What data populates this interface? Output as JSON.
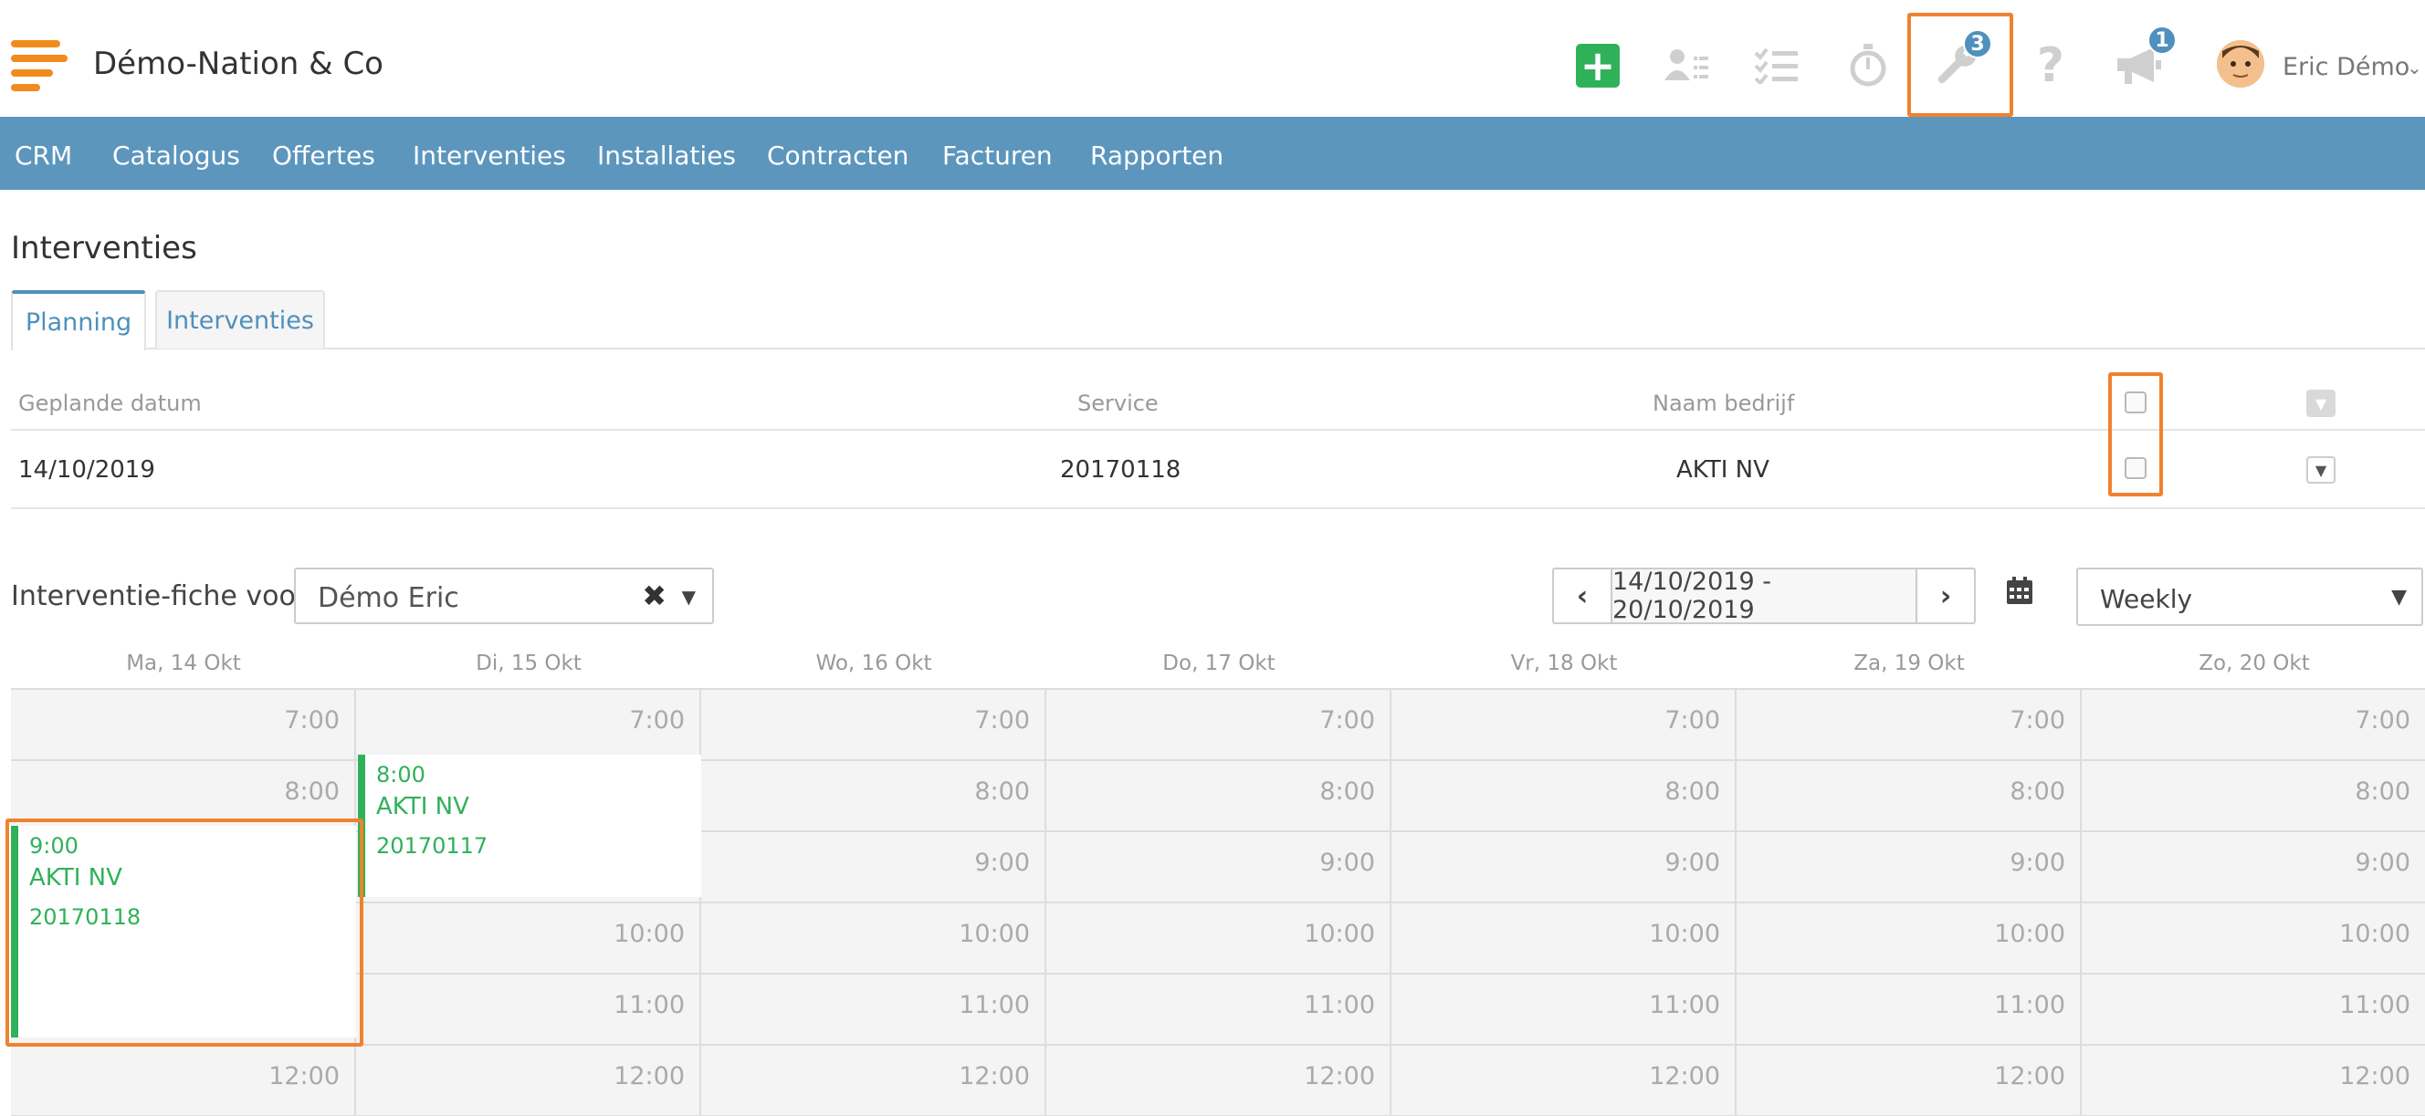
{
  "header": {
    "company": "Démo-Nation & Co",
    "tools_badge": "3",
    "announcements_badge": "1",
    "user_name": "Eric Démo",
    "icons": [
      "plus-icon",
      "contacts-icon",
      "tasks-icon",
      "stopwatch-icon",
      "wrench-icon",
      "help-icon",
      "megaphone-icon",
      "avatar"
    ]
  },
  "nav": {
    "items": [
      "CRM",
      "Catalogus",
      "Offertes",
      "Interventies",
      "Installaties",
      "Contracten",
      "Facturen",
      "Rapporten"
    ]
  },
  "page": {
    "title": "Interventies",
    "tabs": [
      "Planning",
      "Interventies"
    ]
  },
  "table": {
    "headers": [
      "Geplande datum",
      "Service",
      "Naam bedrijf"
    ],
    "rows": [
      {
        "date": "14/10/2019",
        "service": "20170118",
        "company": "AKTI NV"
      }
    ]
  },
  "filter": {
    "label": "Interventie-fiche voor",
    "selected": "Démo Eric",
    "date_range": "14/10/2019 - 20/10/2019",
    "view": "Weekly"
  },
  "calendar": {
    "days": [
      "Ma, 14 Okt",
      "Di, 15 Okt",
      "Wo, 16 Okt",
      "Do, 17 Okt",
      "Vr, 18 Okt",
      "Za, 19 Okt",
      "Zo, 20 Okt"
    ],
    "times": [
      "7:00",
      "8:00",
      "9:00",
      "10:00",
      "11:00",
      "12:00"
    ],
    "events": [
      {
        "time": "8:00",
        "company": "AKTI NV",
        "code": "20170117"
      },
      {
        "time": "9:00",
        "company": "AKTI NV",
        "code": "20170118"
      }
    ]
  },
  "colors": {
    "nav_bg": "#5c96bd",
    "accent_blue": "#4f90bd",
    "green": "#2fb15a",
    "highlight": "#f0822e",
    "logo": "#f28b1e"
  }
}
